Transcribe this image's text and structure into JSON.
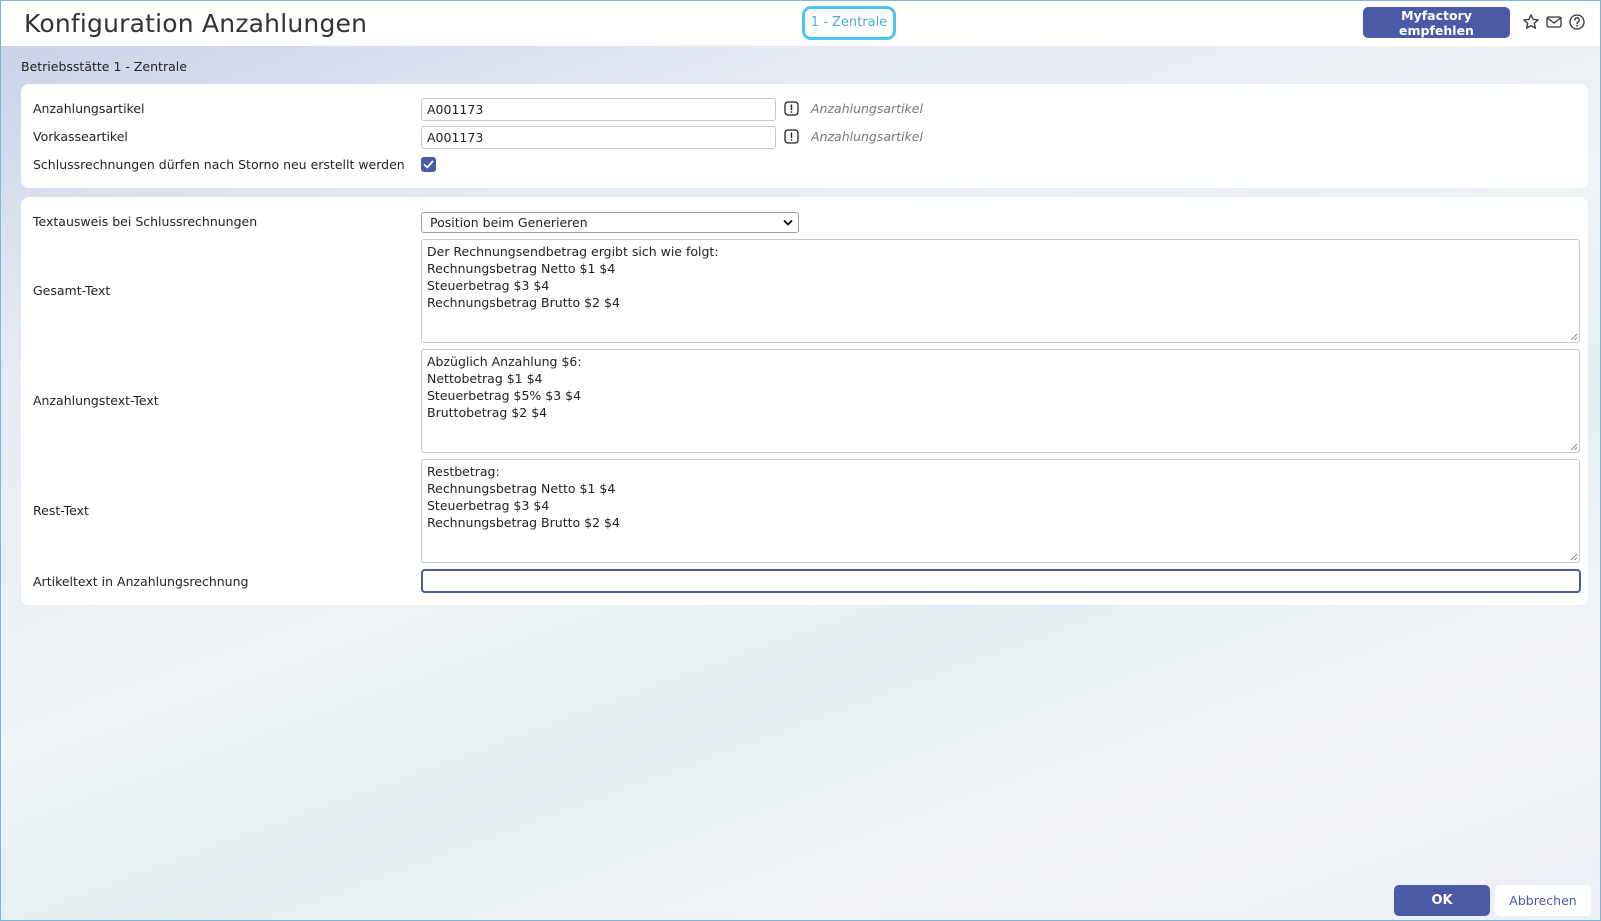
{
  "header": {
    "title": "Konfiguration Anzahlungen",
    "site_badge": "1 - Zentrale",
    "recommend_label": "Myfactory empfehlen",
    "icons": [
      "star-icon",
      "mail-icon",
      "help-icon"
    ]
  },
  "section": {
    "label": "Betriebsstätte 1 - Zentrale"
  },
  "article_settings": {
    "down_payment_article": {
      "label": "Anzahlungsartikel",
      "value": "A001173",
      "hint": "Anzahlungsartikel"
    },
    "prepayment_article": {
      "label": "Vorkasseartikel",
      "value": "A001173",
      "hint": "Anzahlungsartikel"
    },
    "recreate_final_invoices": {
      "label": "Schlussrechnungen dürfen nach Storno neu erstellt werden",
      "checked": true
    }
  },
  "text_settings": {
    "text_display": {
      "label": "Textausweis bei Schlussrechnungen",
      "selected": "Position beim Generieren"
    },
    "total_text": {
      "label": "Gesamt-Text",
      "lines": [
        "Der Rechnungsendbetrag ergibt sich wie folgt:",
        "Rechnungsbetrag Netto $1 $4",
        "Steuerbetrag $3 $4",
        "Rechnungsbetrag Brutto $2 $4"
      ]
    },
    "down_payment_text": {
      "label": "Anzahlungstext-Text",
      "lines": [
        "Abzüglich Anzahlung $6:",
        "Nettobetrag $1 $4",
        "Steuerbetrag $5% $3 $4",
        "Bruttobetrag $2 $4"
      ]
    },
    "rest_text": {
      "label": "Rest-Text",
      "lines": [
        "Restbetrag:",
        "Rechnungsbetrag Netto $1 $4",
        "Steuerbetrag $3 $4",
        "Rechnungsbetrag Brutto $2 $4"
      ]
    },
    "article_text": {
      "label": "Artikeltext in Anzahlungsrechnung",
      "value": ""
    }
  },
  "footer": {
    "ok_label": "OK",
    "cancel_label": "Abbrechen"
  },
  "colors": {
    "accent": "#4a5aa6",
    "badge_border": "#4ec3ef"
  }
}
